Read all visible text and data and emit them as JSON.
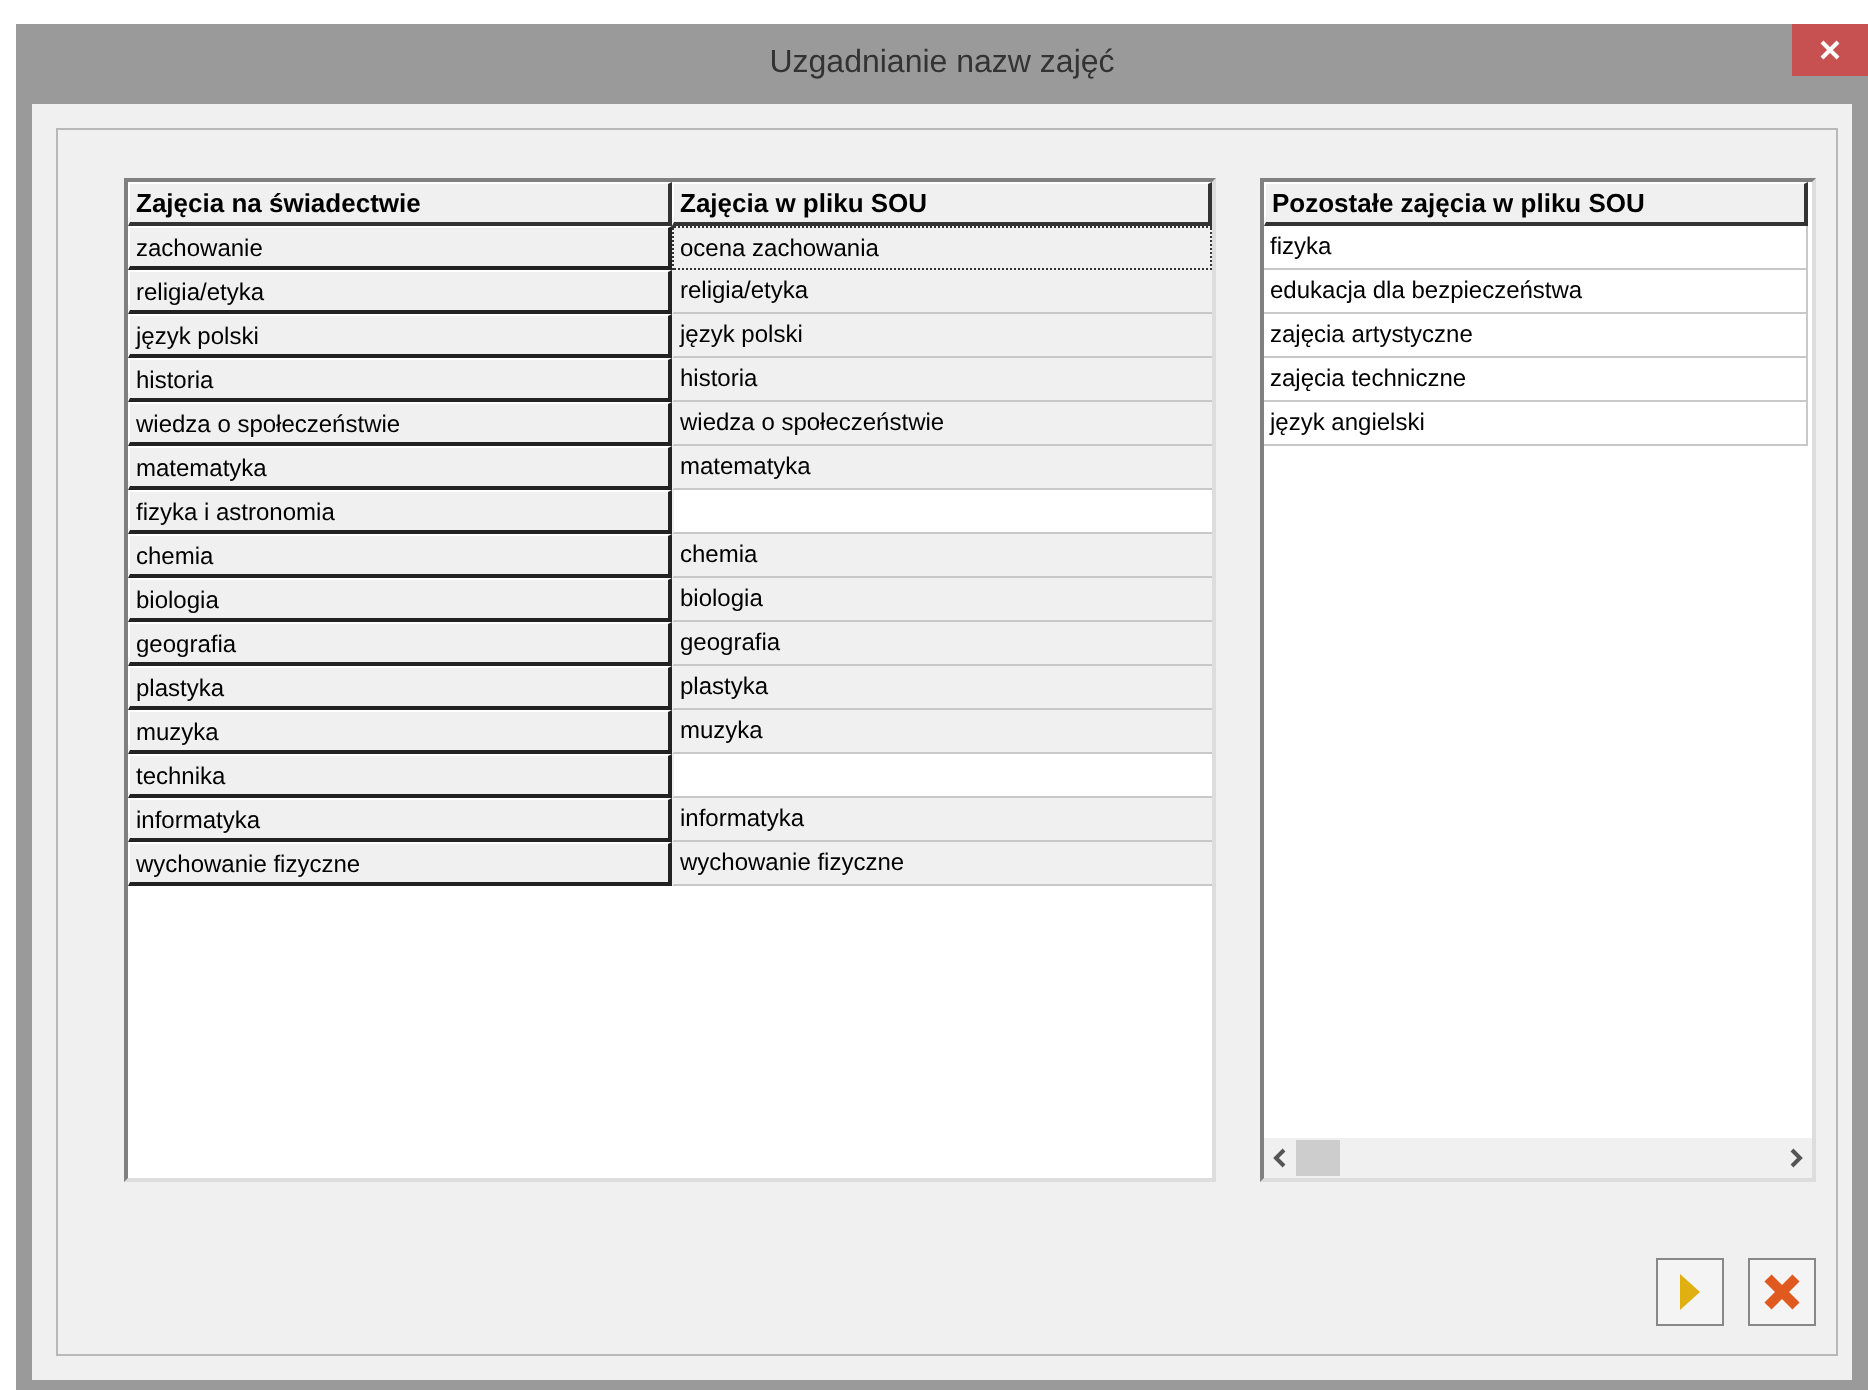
{
  "window": {
    "title": "Uzgadnianie nazw zajęć"
  },
  "mapping_table": {
    "columns": [
      "Zajęcia na świadectwie",
      "Zajęcia w pliku SOU"
    ],
    "rows": [
      {
        "certificate": "zachowanie",
        "sou": "ocena zachowania",
        "focused": true
      },
      {
        "certificate": "religia/etyka",
        "sou": "religia/etyka",
        "focused": false
      },
      {
        "certificate": "język polski",
        "sou": "język polski",
        "focused": false
      },
      {
        "certificate": "historia",
        "sou": "historia",
        "focused": false
      },
      {
        "certificate": "wiedza o społeczeństwie",
        "sou": "wiedza o społeczeństwie",
        "focused": false
      },
      {
        "certificate": "matematyka",
        "sou": "matematyka",
        "focused": false
      },
      {
        "certificate": "fizyka i astronomia",
        "focused": false
      },
      {
        "certificate": "chemia",
        "sou": "chemia",
        "focused": false
      },
      {
        "certificate": "biologia",
        "sou": "biologia",
        "focused": false
      },
      {
        "certificate": "geografia",
        "sou": "geografia",
        "focused": false
      },
      {
        "certificate": "plastyka",
        "sou": "plastyka",
        "focused": false
      },
      {
        "certificate": "muzyka",
        "sou": "muzyka",
        "focused": false
      },
      {
        "certificate": "technika",
        "focused": false
      },
      {
        "certificate": "informatyka",
        "sou": "informatyka",
        "focused": false
      },
      {
        "certificate": "wychowanie fizyczne",
        "sou": "wychowanie fizyczne",
        "focused": false
      }
    ]
  },
  "remaining_list": {
    "column": "Pozostałe zajęcia w pliku SOU",
    "items": [
      "fizyka",
      "edukacja dla bezpieczeństwa",
      "zajęcia artystyczne",
      "zajęcia techniczne",
      "język angielski"
    ]
  }
}
